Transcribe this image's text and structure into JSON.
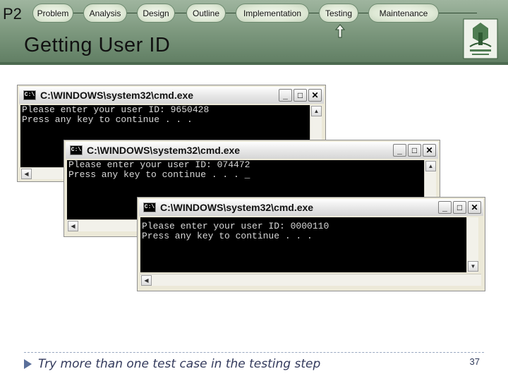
{
  "slide": {
    "badge": "P2",
    "nav": [
      {
        "label": "Problem"
      },
      {
        "label": "Analysis"
      },
      {
        "label": "Design"
      },
      {
        "label": "Outline"
      },
      {
        "label": "Implementation"
      },
      {
        "label": "Testing"
      },
      {
        "label": "Maintenance"
      }
    ],
    "active_stage": "Testing",
    "title": "Getting User ID",
    "footer_text": "Try more than one test case in the testing step",
    "page_number": "37"
  },
  "windows": [
    {
      "title": "C:\\WINDOWS\\system32\\cmd.exe",
      "lines": [
        "Please enter your user ID: 9650428",
        "Press any key to continue . . ."
      ]
    },
    {
      "title": "C:\\WINDOWS\\system32\\cmd.exe",
      "lines": [
        "Please enter your user ID: 074472",
        "Press any key to continue . . . _"
      ]
    },
    {
      "title": "C:\\WINDOWS\\system32\\cmd.exe",
      "lines": [
        "Please enter your user ID: 0000110",
        "Press any key to continue . . ."
      ]
    }
  ],
  "window_controls": {
    "minimize": "_",
    "maximize": "□",
    "close": "✕"
  },
  "icons": {
    "console": "cmd-icon",
    "arrow": "up-arrow-icon",
    "logo": "university-logo-icon"
  },
  "colors": {
    "header": "#7f9a80",
    "console_bg": "#000000",
    "console_text": "#d8d8d8",
    "footer_text": "#333a5c"
  }
}
